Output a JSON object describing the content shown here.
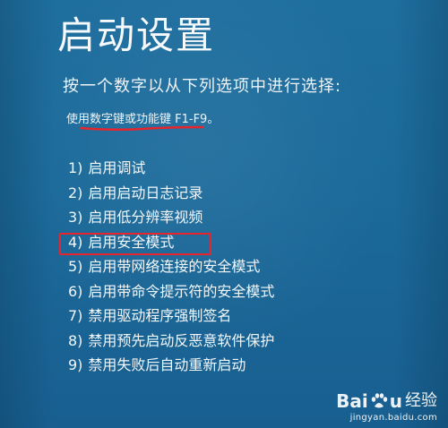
{
  "screen": {
    "title": "启动设置",
    "subtitle": "按一个数字以从下列选项中进行选择:",
    "instruction": "使用数字键或功能键 F1-F9。",
    "highlight_color": "#e8242c"
  },
  "options": [
    {
      "num": "1)",
      "label": "启用调试"
    },
    {
      "num": "2)",
      "label": "启用启动日志记录"
    },
    {
      "num": "3)",
      "label": "启用低分辨率视频"
    },
    {
      "num": "4)",
      "label": "启用安全模式"
    },
    {
      "num": "5)",
      "label": "启用带网络连接的安全模式"
    },
    {
      "num": "6)",
      "label": "启用带命令提示符的安全模式"
    },
    {
      "num": "7)",
      "label": "禁用驱动程序强制签名"
    },
    {
      "num": "8)",
      "label": "禁用预先启动反恶意软件保护"
    },
    {
      "num": "9)",
      "label": "禁用失败后自动重新启动"
    }
  ],
  "watermark": {
    "brand_left": "Bai",
    "brand_right": "u",
    "sub": "经验",
    "url": "jingyan.baidu.com",
    "icon": "paw-icon"
  }
}
